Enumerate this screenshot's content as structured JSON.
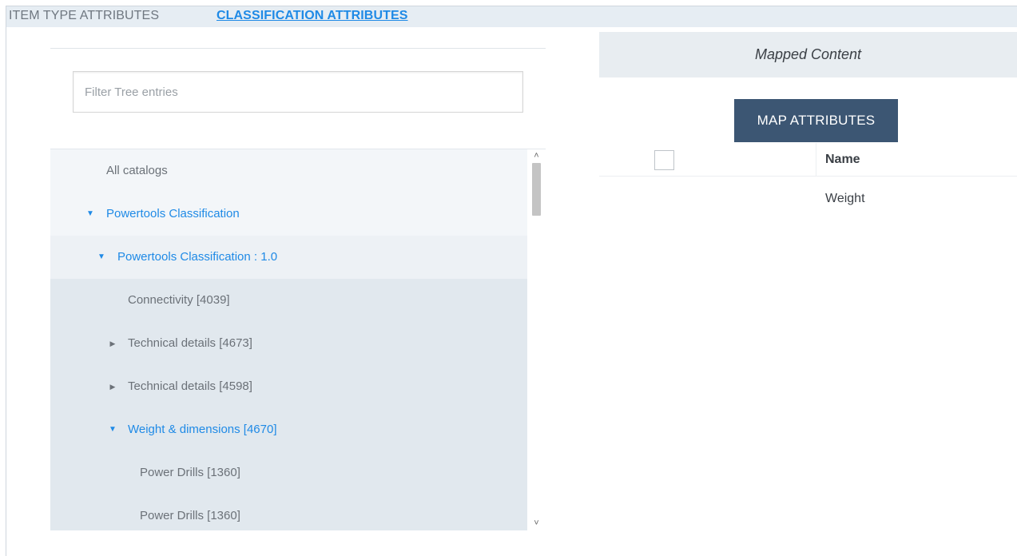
{
  "tabs": {
    "item_type": "ITEM TYPE ATTRIBUTES",
    "classification": "CLASSIFICATION ATTRIBUTES"
  },
  "filter": {
    "placeholder": "Filter Tree entries",
    "value": ""
  },
  "tree": {
    "rows": [
      {
        "label": "All catalogs",
        "arrow": "",
        "expanded": false
      },
      {
        "label": "Powertools Classification",
        "arrow": "▼",
        "expanded": true
      },
      {
        "label": "Powertools Classification : 1.0",
        "arrow": "▼",
        "expanded": true
      },
      {
        "label": "Connectivity [4039]",
        "arrow": "",
        "expanded": false
      },
      {
        "label": "Technical details [4673]",
        "arrow": "▶",
        "expanded": false
      },
      {
        "label": "Technical details [4598]",
        "arrow": "▶",
        "expanded": false
      },
      {
        "label": "Weight & dimensions [4670]",
        "arrow": "▼",
        "expanded": true
      },
      {
        "label": "Power Drills [1360]",
        "arrow": "",
        "expanded": false
      },
      {
        "label": "Power Drills [1360]",
        "arrow": "",
        "expanded": false
      }
    ],
    "scroll_up": "˄",
    "scroll_down": "˅"
  },
  "mapped": {
    "header": "Mapped Content",
    "button_label": "MAP ATTRIBUTES",
    "column_name": "Name",
    "rows": [
      {
        "name": "Weight"
      }
    ]
  },
  "colors": {
    "accent_blue": "#1f8ae6",
    "button_bg": "#3c5673"
  }
}
